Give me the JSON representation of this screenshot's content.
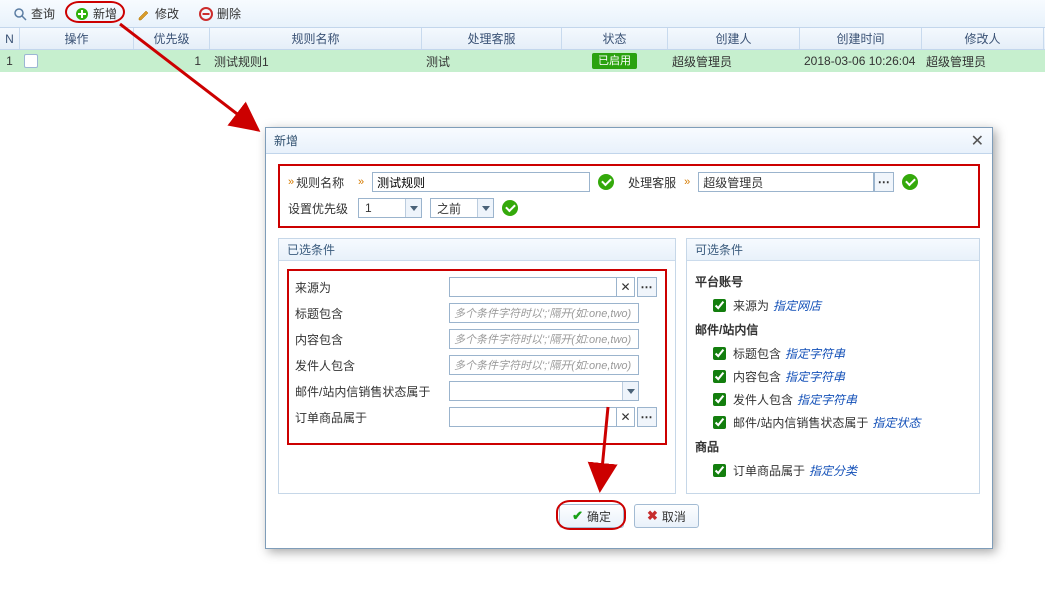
{
  "toolbar": {
    "query": "查询",
    "add": "新增",
    "edit": "修改",
    "delete": "删除"
  },
  "grid": {
    "head": {
      "n": "N",
      "op": "操作",
      "priority": "优先级",
      "name": "规则名称",
      "service": "处理客服",
      "state": "状态",
      "createdBy": "创建人",
      "createdTime": "创建时间",
      "modifiedBy": "修改人"
    },
    "row": {
      "n": "1",
      "priority": "1",
      "name": "测试规则1",
      "service": "测试",
      "state": "已启用",
      "createdBy": "超级管理员",
      "createdTime": "2018-03-06 10:26:04",
      "modifiedBy": "超级管理员"
    }
  },
  "dialog": {
    "title": "新增",
    "form": {
      "nameLabel": "规则名称",
      "nameValue": "测试规则",
      "svcLabel": "处理客服",
      "svcValue": "超级管理员",
      "priLabel": "设置优先级",
      "priValue": "1",
      "posValue": "之前"
    },
    "leftTitle": "已选条件",
    "rightTitle": "可选条件",
    "left": {
      "source": "来源为",
      "titleContains": "标题包含",
      "contentContains": "内容包含",
      "senderContains": "发件人包含",
      "mailState": "邮件/站内信销售状态属于",
      "orderItem": "订单商品属于",
      "placeholder": "多个条件字符时以';'隔开(如:one,two)"
    },
    "right": {
      "platform": "平台账号",
      "sourceIs": "来源为",
      "sourceLink": "指定网店",
      "mailCat": "邮件/站内信",
      "titleContains": "标题包含",
      "contentContains": "内容包含",
      "senderContains": "发件人包含",
      "strLink": "指定字符串",
      "mailStateIs": "邮件/站内信销售状态属于",
      "stateLink": "指定状态",
      "goodsCat": "商品",
      "orderGoods": "订单商品属于",
      "catLink": "指定分类"
    },
    "ok": "确定",
    "cancel": "取消"
  }
}
